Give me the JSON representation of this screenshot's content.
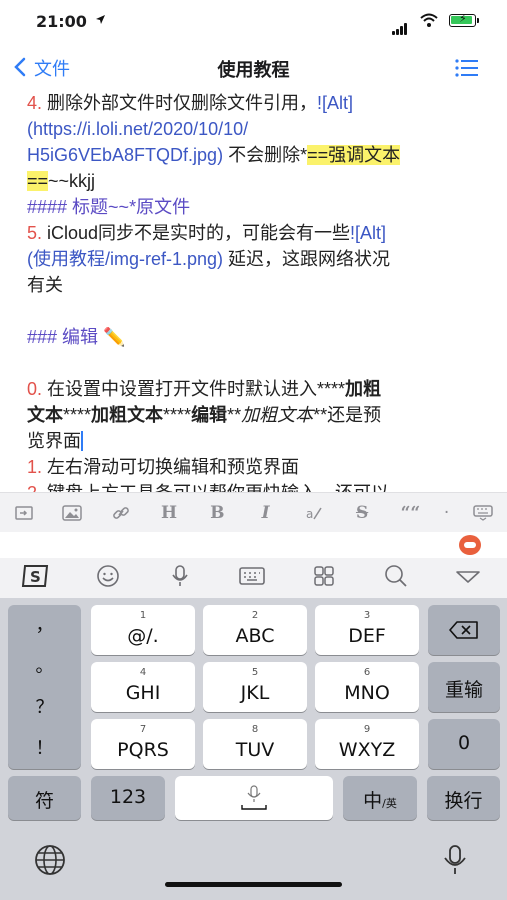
{
  "status_bar": {
    "time": "21:00",
    "location_icon": "location-arrow-icon"
  },
  "nav": {
    "back_label": "文件",
    "title": "使用教程",
    "menu_icon": "list-icon"
  },
  "editor": {
    "l1a": "4.",
    "l1b": " 删除外部文件时仅删除文件引用，",
    "l1c": "![Alt]",
    "l2": "(https://i.loli.net/2020/10/10/",
    "l3a": "H5iG6VEbA8FTQDf.jpg)",
    "l3b": " 不会删除*",
    "l3c": "==强调文本",
    "l4a": "==",
    "l4b": "~~kkjj",
    "l5": "#### 标题~~*原文件",
    "l6a": "5.",
    "l6b": " iCloud同步不是实时的，可能会有一些",
    "l6c": "![Alt]",
    "l7a": "(使用教程/img-ref-1.png)",
    "l7b": " 延迟，这跟网络状况",
    "l8": "有关",
    "l10": "### 编辑 ✏️",
    "l12a": "0.",
    "l12b": " 在设置中设置打开文件时默认进入****",
    "l12c": "加粗",
    "l13a": "文本",
    "l13b": "****",
    "l13c": "加粗文本",
    "l13d": "****",
    "l13e": "编辑",
    "l13f": "**",
    "l13g": "加粗文本",
    "l13h": "**还是预",
    "l14": "览界面",
    "l15a": "1.",
    "l15b": " 左右滑动可切换编辑和预览界面",
    "l16a": "2.",
    "l16b": " 键盘上方工具条可以帮你更快输入，还可以"
  },
  "format_toolbar": {
    "heading": "H",
    "bold": "B",
    "italic": "I",
    "strike": "S",
    "quote": "““",
    "dot": "·"
  },
  "keyboard": {
    "left_punct": [
      "，",
      "。",
      "？",
      "！"
    ],
    "row1": [
      {
        "sub": "1",
        "main": "@/."
      },
      {
        "sub": "2",
        "main": "ABC"
      },
      {
        "sub": "3",
        "main": "DEF"
      }
    ],
    "row2": [
      {
        "sub": "4",
        "main": "GHI"
      },
      {
        "sub": "5",
        "main": "JKL"
      },
      {
        "sub": "6",
        "main": "MNO"
      }
    ],
    "row3": [
      {
        "sub": "7",
        "main": "PQRS"
      },
      {
        "sub": "8",
        "main": "TUV"
      },
      {
        "sub": "9",
        "main": "WXYZ"
      }
    ],
    "reenter": "重输",
    "zero": "0",
    "symbol": "符",
    "num": "123",
    "zh": "中",
    "zh_sub": "/英",
    "newline": "换行"
  },
  "colors": {
    "accent": "#2f7cf6",
    "list_number": "#e2524b",
    "link": "#3c57c4",
    "highlight": "#fbf26b",
    "heading": "#5b4bc4"
  }
}
